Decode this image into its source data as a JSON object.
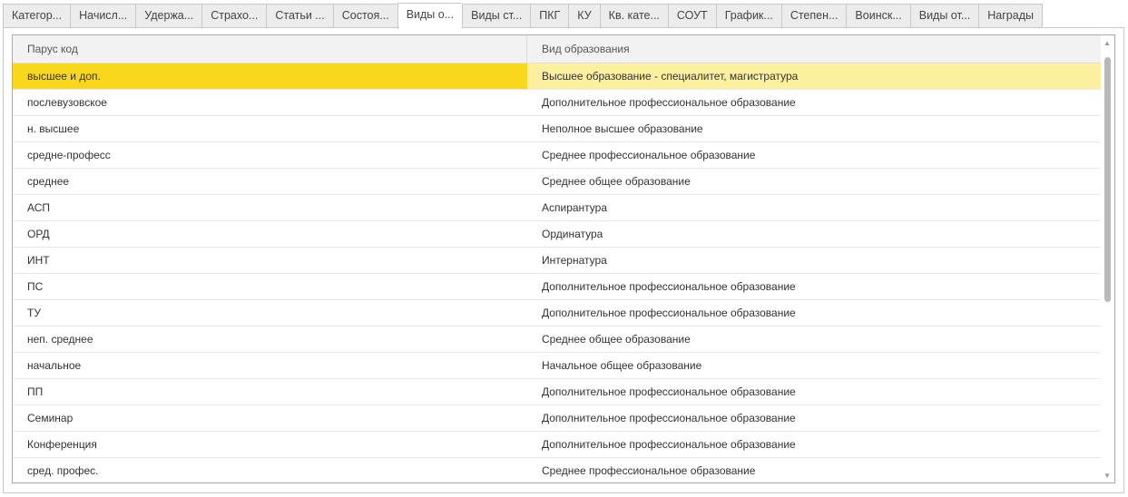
{
  "tabs": [
    "Категор...",
    "Начисл...",
    "Удержа...",
    "Страхо...",
    "Статьи ...",
    "Состоя...",
    "Виды о...",
    "Виды ст...",
    "ПКГ",
    "КУ",
    "Кв. кате...",
    "СОУТ",
    "График...",
    "Степен...",
    "Воинск...",
    "Виды от...",
    "Награды"
  ],
  "active_tab": 6,
  "table": {
    "columns": [
      "Парус код",
      "Вид образования"
    ],
    "selected_row": 0,
    "rows": [
      [
        "высшее и доп.",
        "Высшее образование - специалитет, магистратура"
      ],
      [
        "послевузовское",
        "Дополнительное профессиональное образование"
      ],
      [
        "н. высшее",
        "Неполное высшее образование"
      ],
      [
        "средне-професс",
        "Среднее профессиональное образование"
      ],
      [
        "среднее",
        "Среднее общее образование"
      ],
      [
        "АСП",
        "Аспирантура"
      ],
      [
        "ОРД",
        "Ординатура"
      ],
      [
        "ИНТ",
        "Интернатура"
      ],
      [
        "ПС",
        "Дополнительное профессиональное образование"
      ],
      [
        "ТУ",
        "Дополнительное профессиональное образование"
      ],
      [
        "неп. среднее",
        "Среднее общее образование"
      ],
      [
        "начальное",
        "Начальное общее образование"
      ],
      [
        "ПП",
        "Дополнительное профессиональное образование"
      ],
      [
        "Семинар",
        "Дополнительное профессиональное образование"
      ],
      [
        "Конференция",
        "Дополнительное профессиональное образование"
      ],
      [
        "сред. профес.",
        "Среднее профессиональное образование"
      ]
    ]
  },
  "colors": {
    "selected_cell": "#f9d71c",
    "selected_row": "#fcefa0"
  }
}
